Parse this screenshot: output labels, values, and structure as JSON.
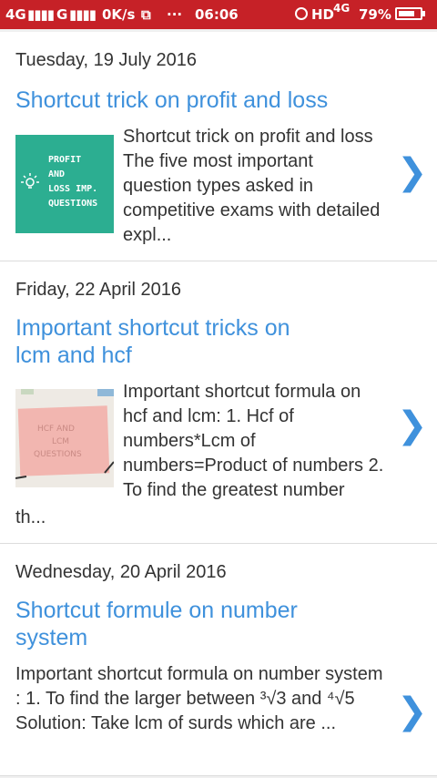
{
  "status": {
    "network_left": "4G",
    "network_mid": "G",
    "speed": "0K/s",
    "time": "06:06",
    "hd": "HD",
    "network_right": "4G",
    "battery": "79%",
    "battery_level": 0.79
  },
  "posts": [
    {
      "date": "Tuesday, 19 July 2016",
      "title": "Shortcut trick on profit and loss",
      "thumb_text": [
        "PROFIT",
        "AND",
        "LOSS IMP.",
        "QUESTIONS"
      ],
      "snippet_side": "Shortcut trick on profit and loss The five most important question types asked in competitive exams with detailed expl...",
      "snippet_tail": ""
    },
    {
      "date": "Friday, 22 April 2016",
      "title_line1": "Important shortcut tricks on",
      "title_line2": "lcm and hcf",
      "thumb_text": [
        "HCF AND",
        "LCM",
        "QUESTIONS"
      ],
      "snippet_side": "Important shortcut formula on hcf and lcm: 1. Hcf of numbers*Lcm of numbers=Product of numbers 2. To find the greatest number",
      "snippet_tail": "th..."
    },
    {
      "date": "Wednesday, 20 April 2016",
      "title_line1": "Shortcut formule on number",
      "title_line2": "system",
      "snippet_full": "Important shortcut formula on number system : 1.  To find the larger between ³√3 and ⁴√5 Solution:   Take lcm of surds which are ..."
    }
  ],
  "chevron": "❯"
}
